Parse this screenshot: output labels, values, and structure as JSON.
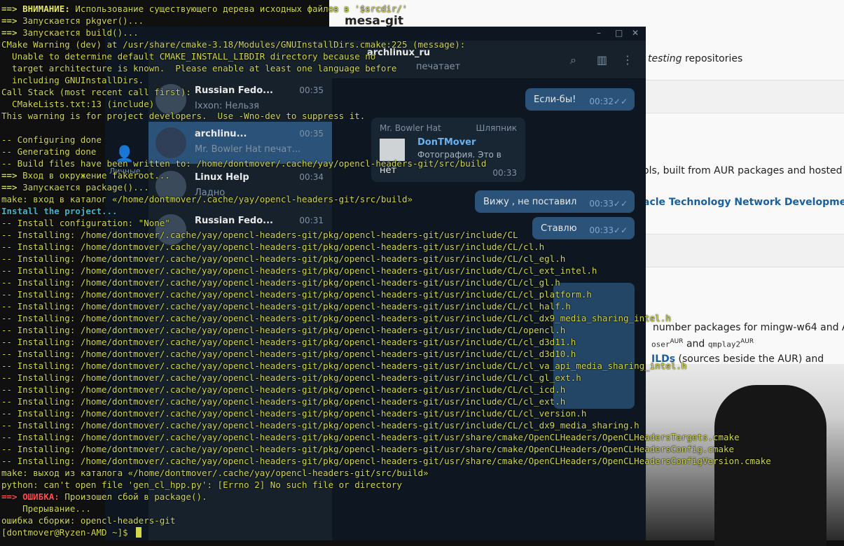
{
  "wiki": {
    "title": "mesa-git",
    "line_repositories_italic": "testing",
    "line_repositories_rest": " repositories",
    "line_tools": "ols, built from AUR packages and hosted",
    "link_oracle": "acle Technology Network Developme",
    "line_mingw": "number packages for mingw-w64 and A",
    "pkg_a": "oser",
    "pkg_b": "qmplay2",
    "sup_aur": "AUR",
    "and_word": " and ",
    "line_sources_link": "ILDs",
    "line_sources": " (sources beside the AUR) and "
  },
  "messenger": {
    "header_username": "archlinux_ru",
    "header_status": "печатает",
    "chats": [
      {
        "name": "Russian Fedo...",
        "time": "00:35",
        "preview": "Ixxon: Нельзя"
      },
      {
        "name": "archlinu...",
        "time": "00:35",
        "preview": "Mr. Bowler Hat печат..."
      },
      {
        "name": "Linux Help",
        "time": "00:34",
        "preview": "Ладно"
      },
      {
        "name": "Russian Fedo...",
        "time": "00:31",
        "preview": ""
      }
    ],
    "rail_label": "Личные",
    "messages": [
      {
        "text": "Если-бы!",
        "time": "00:32"
      },
      {
        "author": "Mr. Bowler Hat",
        "role": "Шляпник",
        "quote_author": "DonTMover",
        "quote_text": "Фотография. Это в",
        "text": "нет",
        "time": "00:33"
      },
      {
        "text": "Вижу , не поставил",
        "time": "00:33"
      },
      {
        "text": "Ставлю",
        "time": "00:33"
      }
    ]
  },
  "terminal": {
    "lines": [
      {
        "parts": [
          {
            "t": "==> ",
            "c": "arrow"
          },
          {
            "t": "ВНИМАНИЕ:",
            "c": "warn-label"
          },
          {
            "t": " Использование существующего дерева исходных файлов в '$srcdir/'",
            "c": ""
          }
        ]
      },
      {
        "parts": [
          {
            "t": "==> ",
            "c": "arrow"
          },
          {
            "t": "Запускается pkgver()...",
            "c": ""
          }
        ]
      },
      {
        "parts": [
          {
            "t": "==> ",
            "c": "arrow"
          },
          {
            "t": "Запускается build()...",
            "c": ""
          }
        ]
      },
      {
        "parts": [
          {
            "t": "CMake Warning (dev) at /usr/share/cmake-3.18/Modules/GNUInstallDirs.cmake:225 (message):",
            "c": ""
          }
        ]
      },
      {
        "parts": [
          {
            "t": "  Unable to determine default CMAKE_INSTALL_LIBDIR directory because no",
            "c": ""
          }
        ]
      },
      {
        "parts": [
          {
            "t": "  target architecture is known.  Please enable at least one language before",
            "c": ""
          }
        ]
      },
      {
        "parts": [
          {
            "t": "  including GNUInstallDirs.",
            "c": ""
          }
        ]
      },
      {
        "parts": [
          {
            "t": "Call Stack (most recent call first):",
            "c": ""
          }
        ]
      },
      {
        "parts": [
          {
            "t": "  CMakeLists.txt:13 (include)",
            "c": ""
          }
        ]
      },
      {
        "parts": [
          {
            "t": "This warning is for project developers.  Use -Wno-dev to suppress it.",
            "c": ""
          }
        ]
      },
      {
        "parts": [
          {
            "t": "",
            "c": ""
          }
        ]
      },
      {
        "parts": [
          {
            "t": "-- Configuring done",
            "c": ""
          }
        ]
      },
      {
        "parts": [
          {
            "t": "-- Generating done",
            "c": ""
          }
        ]
      },
      {
        "parts": [
          {
            "t": "-- Build files have been written to: /home/dontmover/.cache/yay/opencl-headers-git/src/build",
            "c": ""
          }
        ]
      },
      {
        "parts": [
          {
            "t": "==> ",
            "c": "arrow"
          },
          {
            "t": "Вход в окружение fakeroot...",
            "c": ""
          }
        ]
      },
      {
        "parts": [
          {
            "t": "==> ",
            "c": "arrow"
          },
          {
            "t": "Запускается package()...",
            "c": ""
          }
        ]
      },
      {
        "parts": [
          {
            "t": "make: вход в каталог «/home/dontmover/.cache/yay/opencl-headers-git/src/build»",
            "c": ""
          }
        ]
      },
      {
        "cls": "cyan",
        "parts": [
          {
            "t": "Install the project...",
            "c": ""
          }
        ]
      },
      {
        "parts": [
          {
            "t": "-- Install configuration: \"None\"",
            "c": ""
          }
        ]
      },
      {
        "parts": [
          {
            "t": "-- Installing: /home/dontmover/.cache/yay/opencl-headers-git/pkg/opencl-headers-git/usr/include/CL",
            "c": ""
          }
        ]
      },
      {
        "parts": [
          {
            "t": "-- Installing: /home/dontmover/.cache/yay/opencl-headers-git/pkg/opencl-headers-git/usr/include/CL/cl.h",
            "c": ""
          }
        ]
      },
      {
        "parts": [
          {
            "t": "-- Installing: /home/dontmover/.cache/yay/opencl-headers-git/pkg/opencl-headers-git/usr/include/CL/cl_egl.h",
            "c": ""
          }
        ]
      },
      {
        "parts": [
          {
            "t": "-- Installing: /home/dontmover/.cache/yay/opencl-headers-git/pkg/opencl-headers-git/usr/include/CL/cl_ext_intel.h",
            "c": ""
          }
        ]
      },
      {
        "parts": [
          {
            "t": "-- Installing: /home/dontmover/.cache/yay/opencl-headers-git/pkg/opencl-headers-git/usr/include/CL/cl_gl.h",
            "c": ""
          }
        ]
      },
      {
        "parts": [
          {
            "t": "-- Installing: /home/dontmover/.cache/yay/opencl-headers-git/pkg/opencl-headers-git/usr/include/CL/cl_platform.h",
            "c": ""
          }
        ]
      },
      {
        "parts": [
          {
            "t": "-- Installing: /home/dontmover/.cache/yay/opencl-headers-git/pkg/opencl-headers-git/usr/include/CL/cl_half.h",
            "c": ""
          }
        ]
      },
      {
        "parts": [
          {
            "t": "-- Installing: /home/dontmover/.cache/yay/opencl-headers-git/pkg/opencl-headers-git/usr/include/CL/cl_dx9_media_sharing_intel.h",
            "c": ""
          }
        ]
      },
      {
        "parts": [
          {
            "t": "-- Installing: /home/dontmover/.cache/yay/opencl-headers-git/pkg/opencl-headers-git/usr/include/CL/opencl.h",
            "c": ""
          }
        ]
      },
      {
        "parts": [
          {
            "t": "-- Installing: /home/dontmover/.cache/yay/opencl-headers-git/pkg/opencl-headers-git/usr/include/CL/cl_d3d11.h",
            "c": ""
          }
        ]
      },
      {
        "parts": [
          {
            "t": "-- Installing: /home/dontmover/.cache/yay/opencl-headers-git/pkg/opencl-headers-git/usr/include/CL/cl_d3d10.h",
            "c": ""
          }
        ]
      },
      {
        "parts": [
          {
            "t": "-- Installing: /home/dontmover/.cache/yay/opencl-headers-git/pkg/opencl-headers-git/usr/include/CL/cl_va_api_media_sharing_intel.h",
            "c": ""
          }
        ]
      },
      {
        "parts": [
          {
            "t": "-- Installing: /home/dontmover/.cache/yay/opencl-headers-git/pkg/opencl-headers-git/usr/include/CL/cl_gl_ext.h",
            "c": ""
          }
        ]
      },
      {
        "parts": [
          {
            "t": "-- Installing: /home/dontmover/.cache/yay/opencl-headers-git/pkg/opencl-headers-git/usr/include/CL/cl_icd.h",
            "c": ""
          }
        ]
      },
      {
        "parts": [
          {
            "t": "-- Installing: /home/dontmover/.cache/yay/opencl-headers-git/pkg/opencl-headers-git/usr/include/CL/cl_ext.h",
            "c": ""
          }
        ]
      },
      {
        "parts": [
          {
            "t": "-- Installing: /home/dontmover/.cache/yay/opencl-headers-git/pkg/opencl-headers-git/usr/include/CL/cl_version.h",
            "c": ""
          }
        ]
      },
      {
        "parts": [
          {
            "t": "-- Installing: /home/dontmover/.cache/yay/opencl-headers-git/pkg/opencl-headers-git/usr/include/CL/cl_dx9_media_sharing.h",
            "c": ""
          }
        ]
      },
      {
        "parts": [
          {
            "t": "-- Installing: /home/dontmover/.cache/yay/opencl-headers-git/pkg/opencl-headers-git/usr/share/cmake/OpenCLHeaders/OpenCLHeadersTargets.cmake",
            "c": ""
          }
        ]
      },
      {
        "parts": [
          {
            "t": "-- Installing: /home/dontmover/.cache/yay/opencl-headers-git/pkg/opencl-headers-git/usr/share/cmake/OpenCLHeaders/OpenCLHeadersConfig.cmake",
            "c": ""
          }
        ]
      },
      {
        "parts": [
          {
            "t": "-- Installing: /home/dontmover/.cache/yay/opencl-headers-git/pkg/opencl-headers-git/usr/share/cmake/OpenCLHeaders/OpenCLHeadersConfigVersion.cmake",
            "c": ""
          }
        ]
      },
      {
        "parts": [
          {
            "t": "make: выход из каталога «/home/dontmover/.cache/yay/opencl-headers-git/src/build»",
            "c": ""
          }
        ]
      },
      {
        "parts": [
          {
            "t": "python: can't open file 'gen_cl_hpp.py': [Errno 2] No such file or directory",
            "c": ""
          }
        ]
      },
      {
        "parts": [
          {
            "t": "==> ",
            "c": "err-arrow"
          },
          {
            "t": "ОШИБКА:",
            "c": "err-label"
          },
          {
            "t": " Произошел сбой в package().",
            "c": ""
          }
        ]
      },
      {
        "parts": [
          {
            "t": "    Прерывание...",
            "c": ""
          }
        ]
      },
      {
        "parts": [
          {
            "t": "ошибка сборки: opencl-headers-git",
            "c": ""
          }
        ]
      },
      {
        "prompt": true,
        "parts": [
          {
            "t": "[dontmover@Ryzen-AMD ~]$ ",
            "c": ""
          }
        ]
      }
    ]
  }
}
